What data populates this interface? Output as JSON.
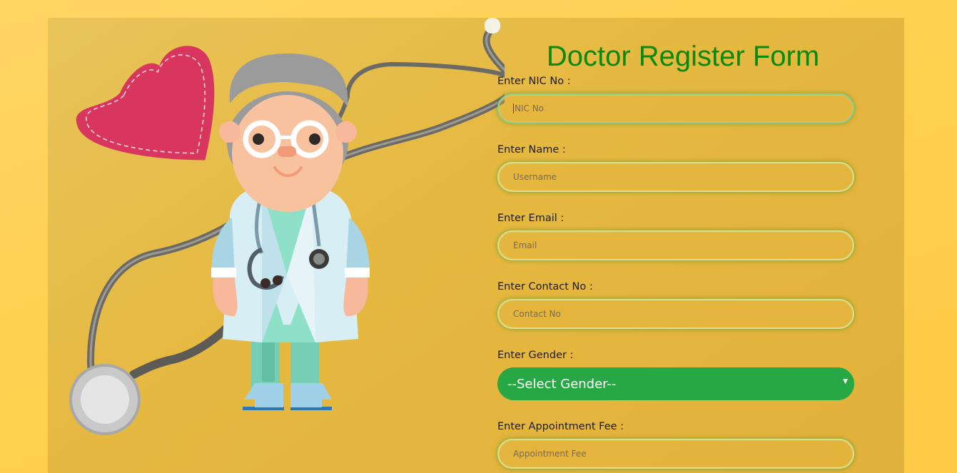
{
  "form": {
    "title": "Doctor Register Form",
    "fields": [
      {
        "label": "Enter NIC No :",
        "placeholder": "NIC No"
      },
      {
        "label": "Enter Name :",
        "placeholder": "Username"
      },
      {
        "label": "Enter Email :",
        "placeholder": "Email"
      },
      {
        "label": "Enter Contact No :",
        "placeholder": "Contact No"
      },
      {
        "label": "Enter Gender :",
        "selected": "--Select Gender--"
      },
      {
        "label": "Enter Appointment Fee :",
        "placeholder": "Appointment Fee"
      }
    ]
  },
  "colors": {
    "title": "#0a8a0a",
    "select_bg": "#28a745",
    "panel": "#e5b83f",
    "page_bg": "#ffd04e"
  },
  "icons": [
    "heart-icon",
    "stethoscope-icon",
    "doctor-illustration"
  ]
}
